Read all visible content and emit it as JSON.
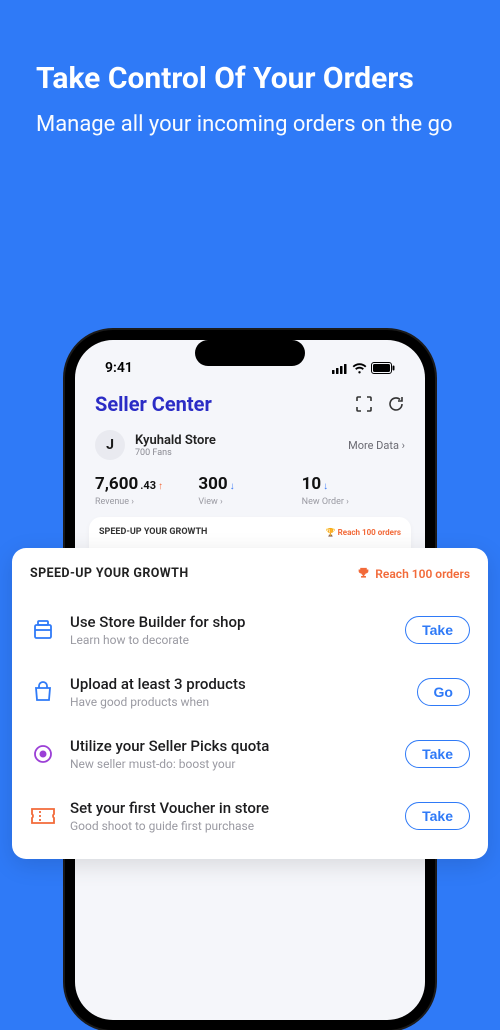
{
  "hero": {
    "title": "Take Control Of Your Orders",
    "subtitle": "Manage all your incoming orders on the go"
  },
  "statusbar": {
    "time": "9:41"
  },
  "header": {
    "title": "Seller Center"
  },
  "store": {
    "name": "Kyuhald Store",
    "fans": "700 Fans",
    "more": "More Data ›"
  },
  "stats": [
    {
      "value": "7,600",
      "decimal": ".43",
      "label": "Revenue ›"
    },
    {
      "value": "300",
      "decimal": "",
      "label": "View ›"
    },
    {
      "value": "10",
      "decimal": "",
      "label": "New Order ›"
    }
  ],
  "growth": {
    "title": "SPEED-UP YOUR GROWTH",
    "reach": "Reach 100 orders",
    "inner_task_sub": "Good shoot to guide first purchase",
    "tasks": [
      {
        "title": "Use Store Builder for shop",
        "sub": "Learn how to decorate",
        "cta": "Take",
        "icon": "store-builder",
        "color": "#2f7af7"
      },
      {
        "title": "Upload at least 3 products",
        "sub": "Have good products when",
        "cta": "Go",
        "icon": "bag",
        "color": "#2f7af7"
      },
      {
        "title": "Utilize your Seller Picks quota",
        "sub": "New seller must-do: boost your",
        "cta": "Take",
        "icon": "picks",
        "color": "#9b3fd6"
      },
      {
        "title": "Set your first Voucher in store",
        "sub": "Good shoot to guide first purchase",
        "cta": "Take",
        "icon": "voucher",
        "color": "#f26a39"
      }
    ]
  }
}
